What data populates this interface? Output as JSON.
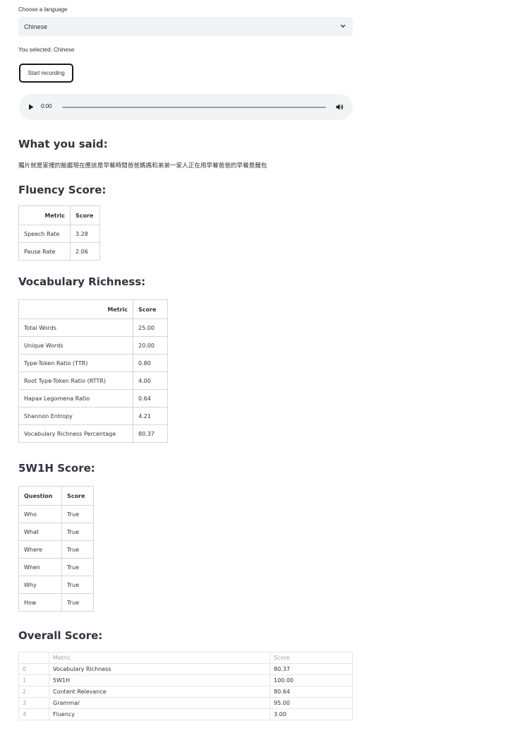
{
  "language": {
    "label": "Choose a language",
    "selected": "Chinese",
    "selected_message": "You selected: Chinese"
  },
  "record_button": "Start recording",
  "audio": {
    "time": "0:00",
    "progress": 0
  },
  "sections": {
    "what_you_said": "What you said:",
    "fluency": "Fluency Score:",
    "vocabulary": "Vocabulary Richness:",
    "fivew1h": "5W1H Score:",
    "overall": "Overall Score:"
  },
  "transcript": "獨片就是家裡的飯廳現在應該是早餐時間爸爸媽媽和弟弟一家人正在用早餐爸爸的早餐是麵包",
  "fluency_table": {
    "headers": [
      "Metric",
      "Score"
    ],
    "rows": [
      [
        "Speech Rate",
        "3.28"
      ],
      [
        "Pause Rate",
        "2.06"
      ]
    ]
  },
  "vocabulary_table": {
    "headers": [
      "Metric",
      "Score"
    ],
    "rows": [
      [
        "Total Words",
        "25.00"
      ],
      [
        "Unique Words",
        "20.00"
      ],
      [
        "Type-Token Ratio (TTR)",
        "0.80"
      ],
      [
        "Root Type-Token Ratio (RTTR)",
        "4.00"
      ],
      [
        "Hapax Legomena Ratio",
        "0.64"
      ],
      [
        "Shannon Entropy",
        "4.21"
      ],
      [
        "Vocabulary Richness Percentage",
        "80.37"
      ]
    ]
  },
  "fivew1h_table": {
    "headers": [
      "Question",
      "Score"
    ],
    "rows": [
      [
        "Who",
        "True"
      ],
      [
        "What",
        "True"
      ],
      [
        "Where",
        "True"
      ],
      [
        "When",
        "True"
      ],
      [
        "Why",
        "True"
      ],
      [
        "How",
        "True"
      ]
    ]
  },
  "overall_table": {
    "headers": [
      "",
      "Metric",
      "Score"
    ],
    "rows": [
      [
        "0",
        "Vocabulary Richness",
        "80.37"
      ],
      [
        "1",
        "5W1H",
        "100.00"
      ],
      [
        "2",
        "Content Relevance",
        "80.64"
      ],
      [
        "3",
        "Grammar",
        "95.00"
      ],
      [
        "4",
        "Fluency",
        "3.00"
      ]
    ]
  },
  "icons": {
    "select": "chevron-down-icon",
    "play": "play-icon",
    "volume": "volume-icon"
  }
}
